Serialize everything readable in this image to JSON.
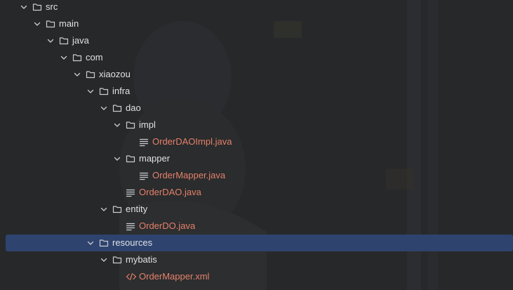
{
  "tree": [
    {
      "label": "src",
      "type": "folder",
      "depth": 0,
      "expanded": true
    },
    {
      "label": "main",
      "type": "folder",
      "depth": 1,
      "expanded": true
    },
    {
      "label": "java",
      "type": "folder",
      "depth": 2,
      "expanded": true
    },
    {
      "label": "com",
      "type": "folder",
      "depth": 3,
      "expanded": true
    },
    {
      "label": "xiaozou",
      "type": "folder",
      "depth": 4,
      "expanded": true
    },
    {
      "label": "infra",
      "type": "folder",
      "depth": 5,
      "expanded": true
    },
    {
      "label": "dao",
      "type": "folder",
      "depth": 6,
      "expanded": true
    },
    {
      "label": "impl",
      "type": "folder",
      "depth": 7,
      "expanded": true
    },
    {
      "label": "OrderDAOImpl.java",
      "type": "java",
      "depth": 8
    },
    {
      "label": "mapper",
      "type": "folder",
      "depth": 7,
      "expanded": true
    },
    {
      "label": "OrderMapper.java",
      "type": "java",
      "depth": 8
    },
    {
      "label": "OrderDAO.java",
      "type": "java",
      "depth": 7
    },
    {
      "label": "entity",
      "type": "folder",
      "depth": 6,
      "expanded": true
    },
    {
      "label": "OrderDO.java",
      "type": "java",
      "depth": 7
    },
    {
      "label": "resources",
      "type": "folder",
      "depth": 5,
      "expanded": true,
      "selected": true
    },
    {
      "label": "mybatis",
      "type": "folder",
      "depth": 6,
      "expanded": true
    },
    {
      "label": "OrderMapper.xml",
      "type": "xml",
      "depth": 7
    }
  ],
  "colors": {
    "background": "#27282a",
    "selection": "#2e436e",
    "folder_text": "#dfe1e5",
    "file_text": "#e5806b",
    "icon": "#c9ccd1"
  }
}
